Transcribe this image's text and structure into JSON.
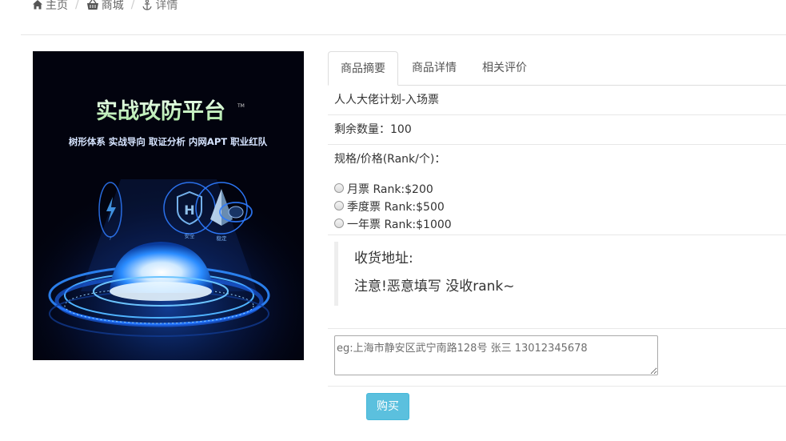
{
  "breadcrumb": {
    "home": "主页",
    "mall": "商城",
    "detail": "详情",
    "separator": "/"
  },
  "product_image": {
    "title": "实战攻防平台",
    "subtitle": "树形体系 实战导向 取证分析 内网APT 职业红队",
    "badge": "TM",
    "icon_label_1": "安全",
    "icon_label_2": "稳定"
  },
  "tabs": [
    {
      "label": "商品摘要",
      "active": true
    },
    {
      "label": "商品详情",
      "active": false
    },
    {
      "label": "相关评价",
      "active": false
    }
  ],
  "product": {
    "name": "人人大佬计划-入场票",
    "stock": "剩余数量：100",
    "spec_title": "规格/价格(Rank/个)：",
    "options": [
      {
        "label": "月票 Rank:$200",
        "checked": false
      },
      {
        "label": "季度票 Rank:$500",
        "checked": false
      },
      {
        "label": "一年票 Rank:$1000",
        "checked": false
      }
    ]
  },
  "address": {
    "title": "收货地址:",
    "note": "注意!恶意填写 没收rank~",
    "placeholder": "eg:上海市静安区武宁南路128号 张三 13012345678",
    "value": ""
  },
  "buy_button": "购买",
  "colors": {
    "accent": "#5bc0de",
    "glow": "#1e90ff",
    "image_bg": "#02030e"
  },
  "icons": [
    "home-icon",
    "basket-icon",
    "anchor-icon"
  ]
}
